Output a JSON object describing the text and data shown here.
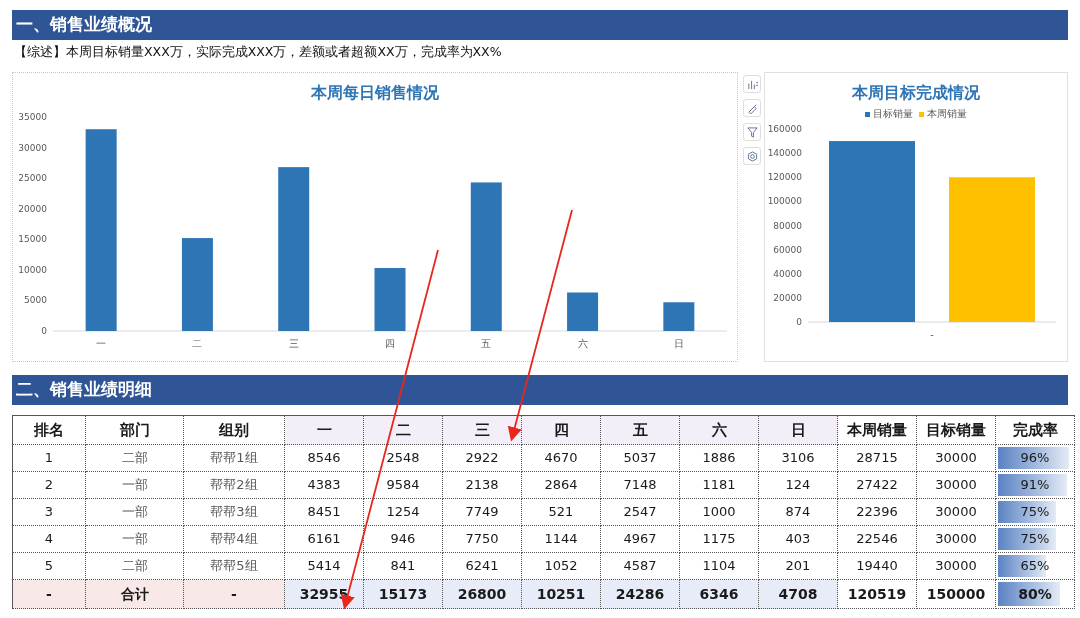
{
  "section1": {
    "title": "一、销售业绩概况"
  },
  "summary": "【综述】本周目标销量XXX万，实际完成XXX万，差额或者超额XX万，完成率为XX%",
  "daily_chart": {
    "chart_data": {
      "type": "bar",
      "title": "本周每日销售情况",
      "categories": [
        "一",
        "二",
        "三",
        "四",
        "五",
        "六",
        "日"
      ],
      "series": [
        {
          "color": "#2e75b6",
          "values": [
            33000,
            15200,
            26800,
            10300,
            24300,
            6300,
            4700
          ]
        }
      ],
      "ylim": [
        0,
        35000
      ],
      "yticks": [
        0,
        5000,
        10000,
        15000,
        20000,
        25000,
        30000,
        35000
      ]
    }
  },
  "target_chart": {
    "chart_data": {
      "type": "bar",
      "title": "本周目标完成情况",
      "categories": [
        "-"
      ],
      "series": [
        {
          "name": "目标销量",
          "color": "#2e75b6",
          "values": [
            150000
          ]
        },
        {
          "name": "本周销量",
          "color": "#ffc000",
          "values": [
            120000
          ]
        }
      ],
      "ylim": [
        0,
        160000
      ],
      "yticks": [
        0,
        20000,
        40000,
        60000,
        80000,
        100000,
        120000,
        140000,
        160000
      ]
    }
  },
  "section2": {
    "title": "二、销售业绩明细"
  },
  "table": {
    "columns": [
      "排名",
      "部门",
      "组别",
      "一",
      "二",
      "三",
      "四",
      "五",
      "六",
      "日",
      "本周销量",
      "目标销量",
      "完成率"
    ],
    "rows": [
      {
        "cells": [
          "1",
          "二部",
          "帮帮1组",
          "8546",
          "2548",
          "2922",
          "4670",
          "5037",
          "1886",
          "3106",
          "28715",
          "30000",
          "96%"
        ],
        "level": 0.96
      },
      {
        "cells": [
          "2",
          "一部",
          "帮帮2组",
          "4383",
          "9584",
          "2138",
          "2864",
          "7148",
          "1181",
          "124",
          "27422",
          "30000",
          "91%"
        ],
        "level": 0.93
      },
      {
        "cells": [
          "3",
          "一部",
          "帮帮3组",
          "8451",
          "1254",
          "7749",
          "521",
          "2547",
          "1000",
          "874",
          "22396",
          "30000",
          "75%"
        ],
        "level": 0.79
      },
      {
        "cells": [
          "4",
          "一部",
          "帮帮4组",
          "6161",
          "946",
          "7750",
          "1144",
          "4967",
          "1175",
          "403",
          "22546",
          "30000",
          "75%"
        ],
        "level": 0.79
      },
      {
        "cells": [
          "5",
          "二部",
          "帮帮5组",
          "5414",
          "841",
          "6241",
          "1052",
          "4587",
          "1104",
          "201",
          "19440",
          "30000",
          "65%"
        ],
        "level": 0.67
      }
    ],
    "total": {
      "cells": [
        "-",
        "合计",
        "-",
        "32955",
        "15173",
        "26800",
        "10251",
        "24286",
        "6346",
        "4708",
        "120519",
        "150000",
        "80%"
      ],
      "level": 0.85
    }
  }
}
